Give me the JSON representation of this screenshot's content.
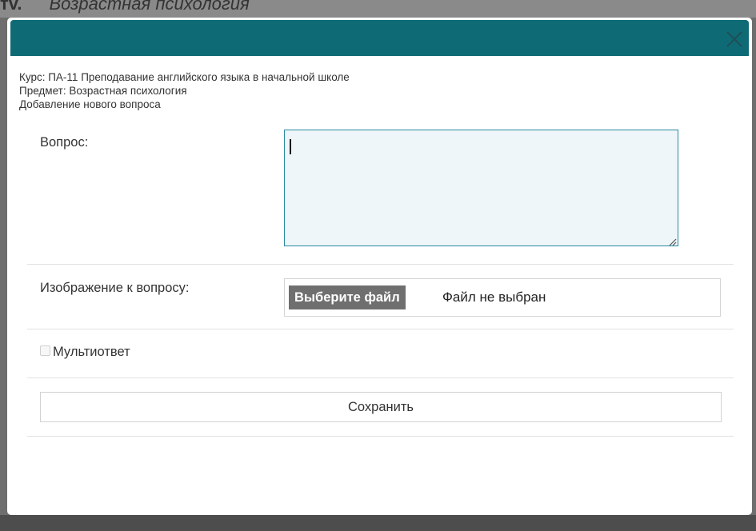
{
  "backdrop": {
    "heading_left": "тv.",
    "heading_right": "Возрастная психология"
  },
  "modal": {
    "close_icon": "close-icon",
    "meta": {
      "course": "Курс: ПА-11 Преподавание английского языка в начальной школе",
      "subject": "Предмет: Возрастная психология",
      "action": "Добавление нового вопроса"
    },
    "question_label": "Вопрос:",
    "question_value": "",
    "image_label": "Изображение к вопросу:",
    "file_button_label": "Выберите файл",
    "file_status": "Файл не выбран",
    "multi_answer_label": "Мультиответ",
    "multi_answer_checked": false,
    "save_label": "Сохранить"
  },
  "colors": {
    "header": "#0e6b76",
    "textarea_border": "#2b8aa0",
    "textarea_bg": "#eef6f9",
    "file_button_bg": "#6f6f6f"
  }
}
